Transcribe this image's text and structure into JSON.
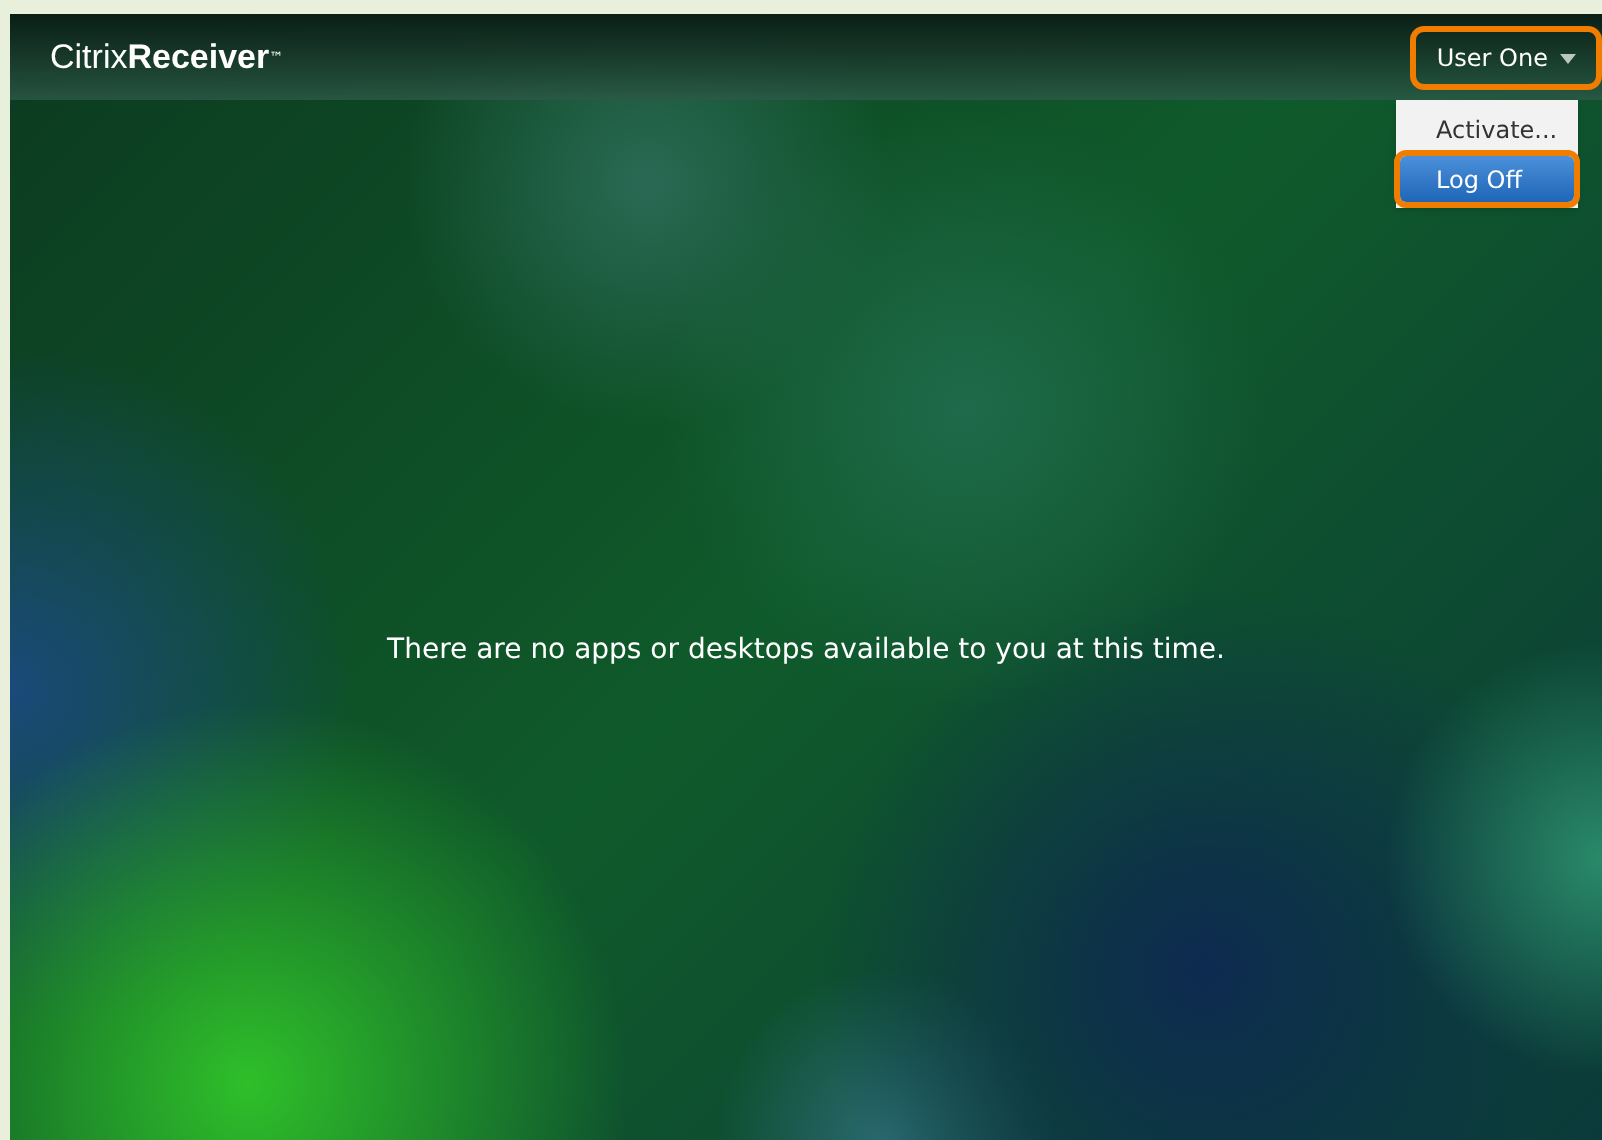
{
  "brand": {
    "light": "Citrix",
    "bold": "Receiver",
    "mark": "™"
  },
  "user_menu": {
    "label": "User One",
    "expanded": true,
    "highlighted": true
  },
  "menu_items": [
    {
      "label": "Activate...",
      "selected": false,
      "highlighted": false
    },
    {
      "label": "Log Off",
      "selected": true,
      "highlighted": true
    }
  ],
  "message": "There are no apps or desktops available to you at this time."
}
